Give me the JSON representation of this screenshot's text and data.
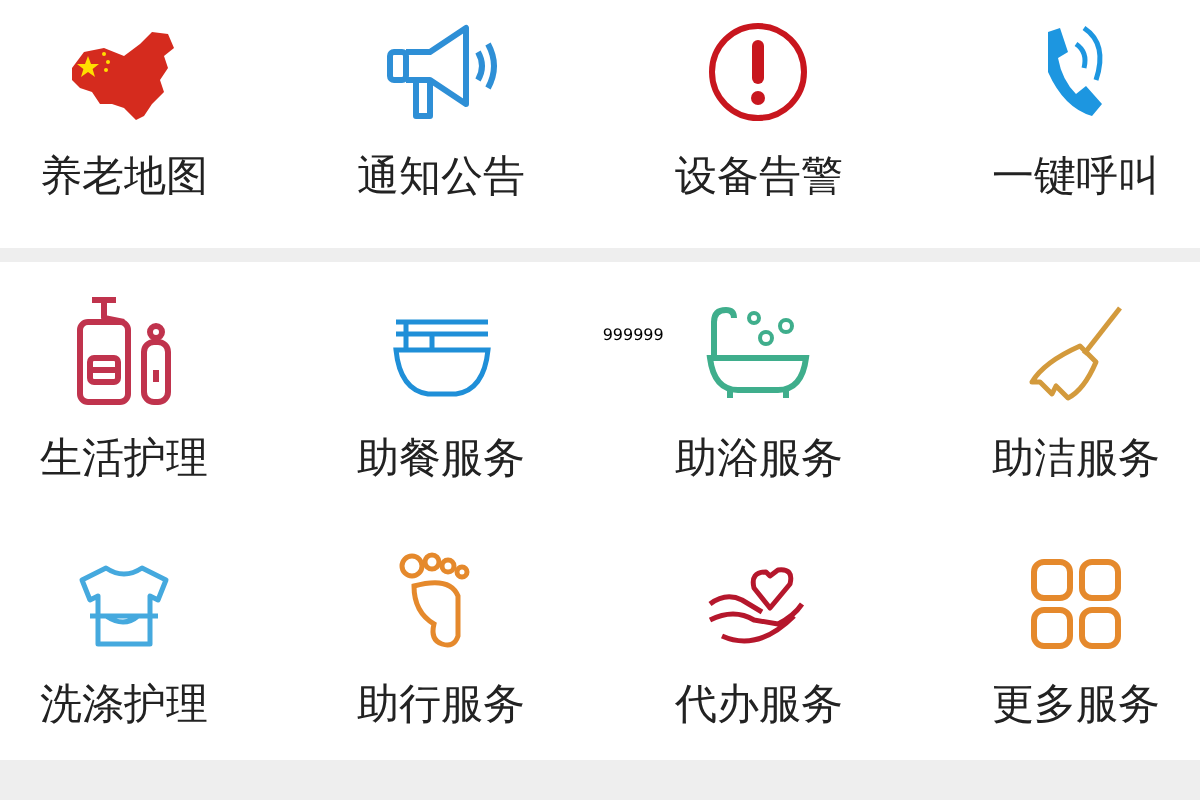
{
  "top_menu": [
    {
      "kind": "map",
      "label": "养老地图"
    },
    {
      "kind": "megaphone",
      "label": "通知公告"
    },
    {
      "kind": "alert",
      "label": "设备告警"
    },
    {
      "kind": "phone",
      "label": "一键呼叫"
    }
  ],
  "services": [
    {
      "kind": "bottles",
      "label": "生活护理"
    },
    {
      "kind": "bowl",
      "label": "助餐服务"
    },
    {
      "kind": "bath",
      "label": "助浴服务",
      "note": "999999"
    },
    {
      "kind": "broom",
      "label": "助洁服务"
    },
    {
      "kind": "shirt",
      "label": "洗涤护理"
    },
    {
      "kind": "foot",
      "label": "助行服务"
    },
    {
      "kind": "hand-heart",
      "label": "代办服务"
    },
    {
      "kind": "grid",
      "label": "更多服务"
    }
  ]
}
